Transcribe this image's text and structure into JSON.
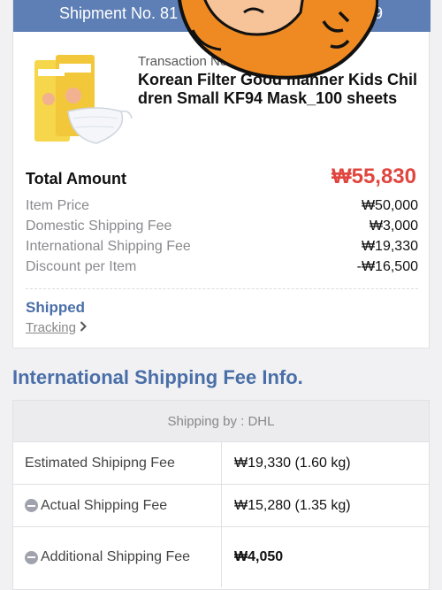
{
  "shipment": {
    "label": "Shipment No. 81",
    "tail": "99"
  },
  "order": {
    "transaction_label": "Transaction No. 3",
    "product_title": "Korean Filter Good manner Kids Children Small KF94 Mask_100 sheets"
  },
  "summary": {
    "total_label": "Total Amount",
    "total_value": "₩55,830",
    "rows": [
      {
        "label": "Item Price",
        "value": "₩50,000"
      },
      {
        "label": "Domestic Shipping Fee",
        "value": "₩3,000"
      },
      {
        "label": "International Shipping Fee",
        "value": "₩19,330"
      },
      {
        "label": "Discount per Item",
        "value": "-₩16,500"
      }
    ]
  },
  "status": {
    "label": "Shipped",
    "tracking_label": "Tracking"
  },
  "intl": {
    "title": "International Shipping Fee Info.",
    "shipping_by": "Shipping by : DHL",
    "rows": [
      {
        "label": "Estimated Shipipng Fee",
        "value": "₩19,330 (1.60 kg)"
      },
      {
        "label": "Actual Shipping Fee",
        "value": "₩15,280 (1.35 kg)"
      },
      {
        "label": "Additional Shipping Fee",
        "value": "₩4,050"
      }
    ]
  },
  "colors": {
    "header_blue": "#5e7fb5",
    "accent_blue": "#4a6fa8",
    "total_red": "#e0463f"
  },
  "icons": {
    "tracking": "chevron-right-icon",
    "deduction": "minus-circle-icon"
  }
}
